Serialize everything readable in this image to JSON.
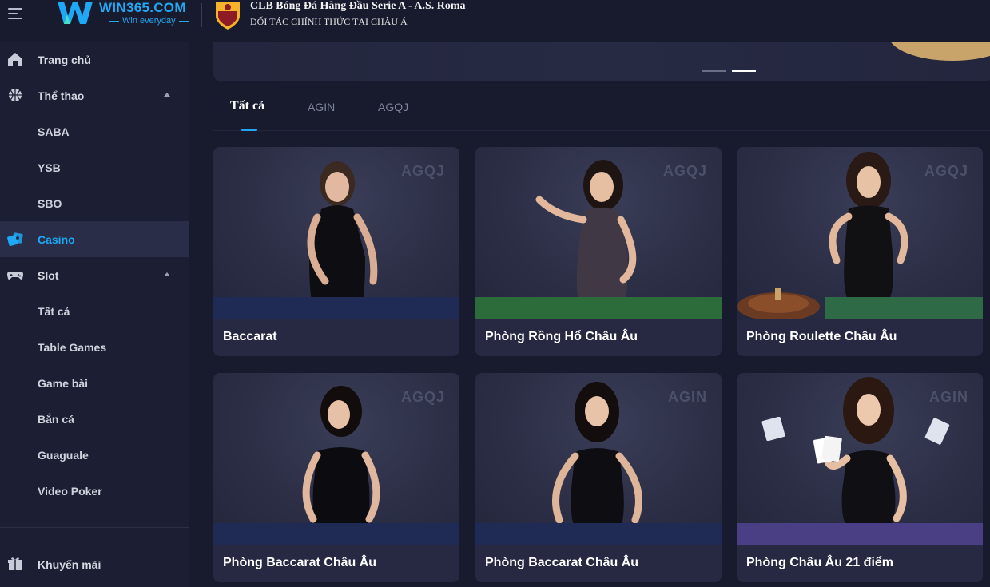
{
  "header": {
    "logo_text": "WIN365.COM",
    "logo_tagline": "Win everyday",
    "partner_title": "CLB Bóng Đá Hàng Đầu Serie A - A.S. Roma",
    "partner_subtitle": "ĐỐI TÁC CHÍNH THỨC TẠI CHÂU Á"
  },
  "sidebar": {
    "items": [
      {
        "label": "Trang chủ"
      },
      {
        "label": "Thể thao"
      },
      {
        "label": "SABA"
      },
      {
        "label": "YSB"
      },
      {
        "label": "SBO"
      },
      {
        "label": "Casino"
      },
      {
        "label": "Slot"
      },
      {
        "label": "Tất cả"
      },
      {
        "label": "Table Games"
      },
      {
        "label": "Game bài"
      },
      {
        "label": "Bắn cá"
      },
      {
        "label": "Guaguale"
      },
      {
        "label": "Video Poker"
      },
      {
        "label": "Khuyến mãi"
      }
    ]
  },
  "tabs": [
    {
      "label": "Tất cả"
    },
    {
      "label": "AGIN"
    },
    {
      "label": "AGQJ"
    }
  ],
  "games": [
    {
      "name": "Baccarat",
      "provider": "AGQJ"
    },
    {
      "name": "Phòng Rồng Hổ Châu Âu",
      "provider": "AGQJ"
    },
    {
      "name": "Phòng Roulette Châu Âu",
      "provider": "AGQJ"
    },
    {
      "name": "Phòng Baccarat Châu Âu",
      "provider": "AGQJ"
    },
    {
      "name": "Phòng Baccarat Châu Âu",
      "provider": "AGIN"
    },
    {
      "name": "Phòng Châu Âu 21 điểm",
      "provider": "AGIN"
    }
  ],
  "colors": {
    "accent": "#1ea8f5",
    "background": "#181b2e",
    "sidebar": "#1c1f34",
    "card": "#262941"
  }
}
